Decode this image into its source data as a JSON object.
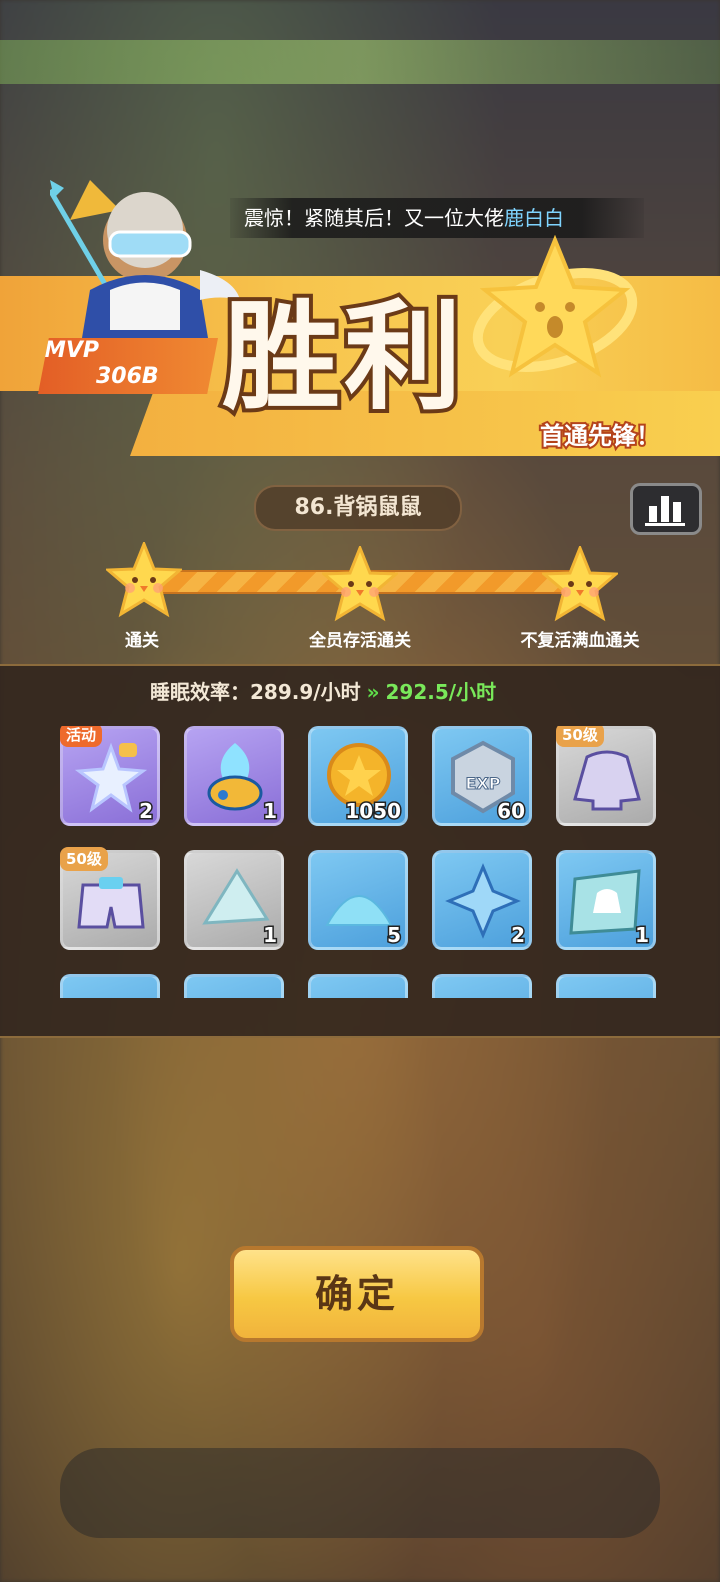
{
  "ticker": {
    "prefix": "震惊！紧随其后！又一位大佬",
    "name": "鹿白白"
  },
  "banner": {
    "title": "胜利",
    "mvp_label": "MVP",
    "mvp_value": "306B",
    "first_clear": "首通先锋！"
  },
  "level": {
    "name": "86.背锅鼠鼠"
  },
  "progress": {
    "stars": [
      {
        "label": "通关"
      },
      {
        "label": "全员存活通关"
      },
      {
        "label": "不复活满血通关"
      }
    ]
  },
  "efficiency": {
    "label": "睡眠效率：",
    "old": "289.9/小时",
    "new": "292.5/小时"
  },
  "rewards": [
    {
      "icon": "star-bottle-icon",
      "count": "2",
      "tag": "活动",
      "style": "purple"
    },
    {
      "icon": "blue-flame-cauldron-icon",
      "count": "1",
      "tag": "",
      "style": "purple"
    },
    {
      "icon": "gold-coin-icon",
      "count": "1050",
      "tag": "",
      "style": "blue"
    },
    {
      "icon": "exp-badge-icon",
      "count": "60",
      "tag": "",
      "style": "blue"
    },
    {
      "icon": "jacket-icon",
      "count": "",
      "tag": "50级",
      "style": "grey"
    },
    {
      "icon": "shorts-icon",
      "count": "",
      "tag": "50级",
      "style": "grey"
    },
    {
      "icon": "crystal-shard-icon",
      "count": "1",
      "tag": "",
      "style": "grey"
    },
    {
      "icon": "blue-powder-icon",
      "count": "5",
      "tag": "",
      "style": "blue"
    },
    {
      "icon": "ice-crystal-icon",
      "count": "2",
      "tag": "",
      "style": "blue"
    },
    {
      "icon": "blueprint-icon",
      "count": "1",
      "tag": "",
      "style": "blue"
    },
    {
      "icon": "reward-icon",
      "count": "",
      "tag": "",
      "style": "blue"
    },
    {
      "icon": "reward-icon",
      "count": "",
      "tag": "",
      "style": "blue"
    },
    {
      "icon": "reward-icon",
      "count": "",
      "tag": "",
      "style": "blue"
    },
    {
      "icon": "reward-icon",
      "count": "",
      "tag": "",
      "style": "blue"
    },
    {
      "icon": "reward-icon",
      "count": "",
      "tag": "",
      "style": "blue"
    }
  ],
  "confirm": {
    "label": "确定"
  },
  "colors": {
    "accent": "#f7c843",
    "highlight_green": "#79e85a"
  }
}
